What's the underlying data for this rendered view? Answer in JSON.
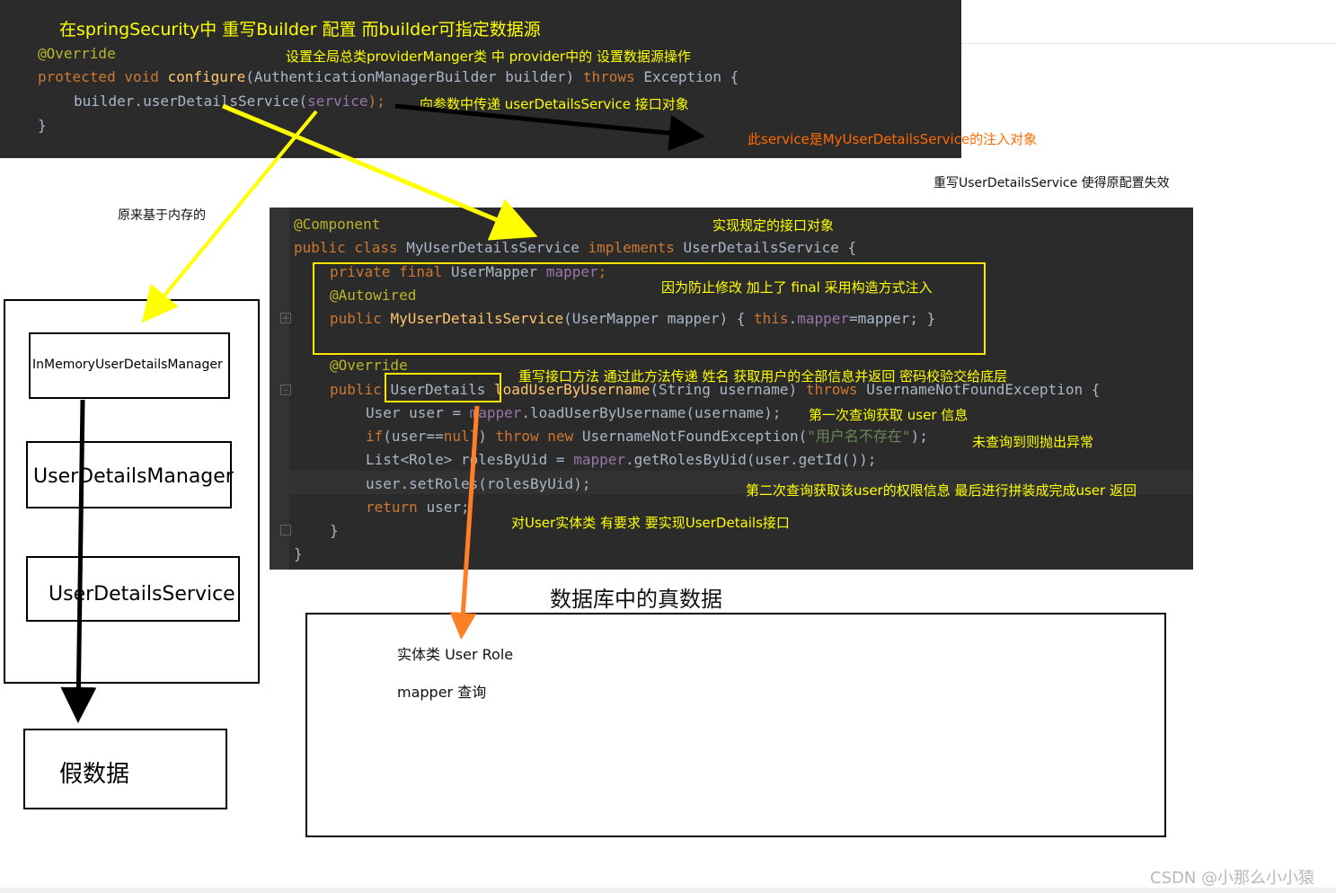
{
  "top_panel": {
    "title": "在springSecurity中 重写Builder 配置 而builder可指定数据源",
    "code": {
      "l1_ann": "@Override",
      "l2_kw1": "protected void ",
      "l2_fn": "configure",
      "l2_rest": "(AuthenticationManagerBuilder builder) ",
      "l2_throws": "throws",
      "l2_exc": " Exception {",
      "l3_a": "builder.userDetailsService(",
      "l3_b": "service",
      "l3_c": ");",
      "l4": "}"
    },
    "note_provider": "设置全局总类providerManger类 中 provider中的 设置数据源操作",
    "note_param": "向参数中传递 userDetailsService 接口对象"
  },
  "note_service": "此service是MyUserDetailsService的注入对象",
  "note_override": "重写UserDetailsService 使得原配置失效",
  "note_memory": "原来基于内存的",
  "main_panel": {
    "c1": "@Component",
    "c2_kw": "public class ",
    "c2_name": "MyUserDetailsService ",
    "c2_impl": "implements ",
    "c2_iface": "UserDetailsService {",
    "c3_kw": "private final ",
    "c3_type": "UserMapper ",
    "c3_field": "mapper",
    "c3_end": ";",
    "c4": "@Autowired",
    "c5_kw": "public ",
    "c5_fn": "MyUserDetailsService",
    "c5_params": "(UserMapper mapper) { ",
    "c5_this": "this",
    "c5_dot": ".",
    "c5_field": "mapper",
    "c5_assign": "=mapper; }",
    "c6": "@Override",
    "c7_kw": "public ",
    "c7_type": "UserDetails",
    "c7_fn": " loadUserByUsername",
    "c7_params": "(String username) ",
    "c7_throws": "throws ",
    "c7_exc": "UsernameNotFoundException {",
    "c8_a": "User user = ",
    "c8_field": "mapper",
    "c8_b": ".loadUserByUsername(username);",
    "c9_kw": "if",
    "c9_a": "(user==",
    "c9_null": "null",
    "c9_b": ") ",
    "c9_throw": "throw new ",
    "c9_c": "UsernameNotFoundException(",
    "c9_str": "\"用户名不存在\"",
    "c9_d": ");",
    "c10_a": "List<Role> rolesByUid = ",
    "c10_field": "mapper",
    "c10_b": ".getRolesByUid(user.getId());",
    "c11": "user.setRoles(rolesByUid);",
    "c12_kw": "return ",
    "c12_b": "user;",
    "c13": "}",
    "c14": "}",
    "note_impl": "实现规定的接口对象",
    "note_final": "因为防止修改 加上了 final 采用构造方式注入",
    "note_override": "重写接口方法  通过此方法传递 姓名 获取用户的全部信息并返回  密码校验交给底层",
    "note_first": "第一次查询获取 user 信息",
    "note_throw": "未查询到则抛出异常",
    "note_second": "第二次查询获取该user的权限信息  最后进行拼装成完成user 返回",
    "note_userdetails": "对User实体类 有要求 要实现UserDetails接口"
  },
  "left_stack": {
    "inmemory": "InMemoryUserDetailsManager",
    "manager": "UserDetailsManager",
    "service": "UserDetailsService",
    "fake": "假数据"
  },
  "db": {
    "title": "数据库中的真数据",
    "entity": "实体类 User Role",
    "mapper": "mapper 查询"
  },
  "watermark": "CSDN @小那么小小猿",
  "colors": {
    "code_bg": "#2b2b2b",
    "annotation_yellow": "#ffff00",
    "annotation_orange": "#ff6a00",
    "arrow_black": "#000000"
  }
}
